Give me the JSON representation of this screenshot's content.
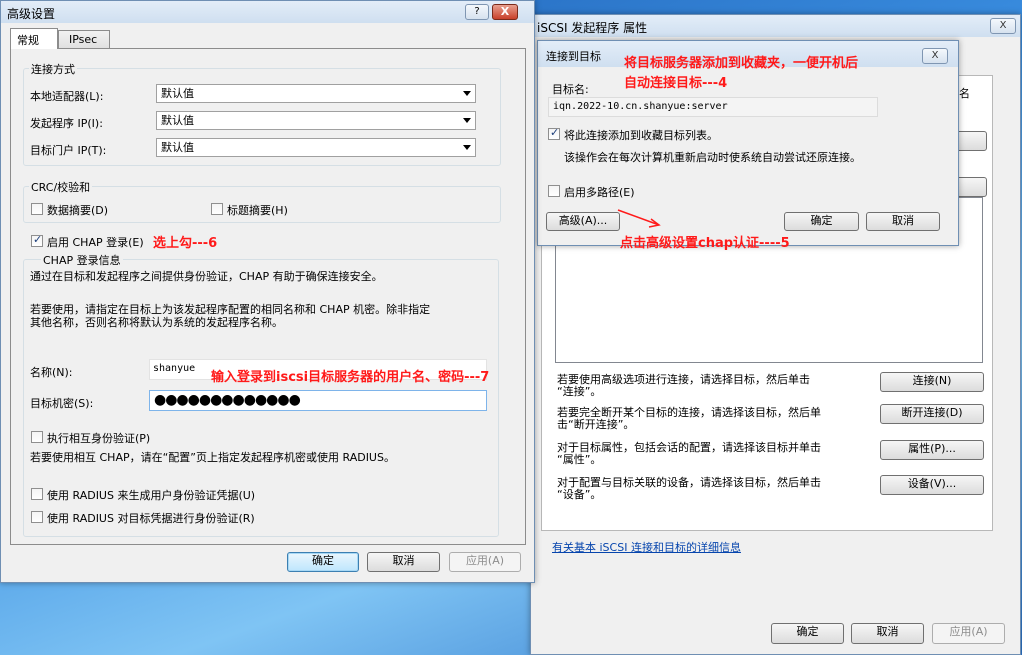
{
  "adv": {
    "title": "高级设置",
    "tabs": [
      "常规",
      "IPsec"
    ],
    "conn_legend": "连接方式",
    "local_adapter_label": "本地适配器(L):",
    "initiator_ip_label": "发起程序 IP(I):",
    "target_portal_label": "目标门户 IP(T):",
    "local_adapter_value": "默认值",
    "initiator_ip_value": "默认值",
    "target_portal_value": "默认值",
    "crc_legend": "CRC/校验和",
    "data_digest": "数据摘要(D)",
    "header_digest": "标题摘要(H)",
    "enable_chap": "启用 CHAP 登录(E)",
    "chap_legend": "CHAP 登录信息",
    "chap_desc1": "通过在目标和发起程序之间提供身份验证，CHAP 有助于确保连接安全。",
    "chap_desc2": "若要使用，请指定在目标上为该发起程序配置的相同名称和 CHAP 机密。除非指定",
    "chap_desc3": "其他名称，否则名称将默认为系统的发起程序名称。",
    "name_label": "名称(N):",
    "name_value": "shanyue",
    "secret_label": "目标机密(S):",
    "secret_value": "●●●●●●●●●●●●●",
    "mutual_auth": "执行相互身份验证(P)",
    "mutual_desc": "若要使用相互 CHAP，请在“配置”页上指定发起程序机密或使用 RADIUS。",
    "radius1": "使用 RADIUS 来生成用户身份验证凭据(U)",
    "radius2": "使用 RADIUS 对目标凭据进行身份验证(R)",
    "ok": "确定",
    "cancel": "取消",
    "apply": "应用(A)",
    "help_icon": "?",
    "close_icon": "X"
  },
  "props": {
    "title": "iSCSI 发起程序 属性",
    "fragment_name": "名",
    "hint1a": "若要使用高级选项进行连接，请选择目标，然后单击",
    "hint1b": "“连接”。",
    "hint2a": "若要完全断开某个目标的连接，请选择该目标，然后单",
    "hint2b": "击“断开连接”。",
    "hint3a": "对于目标属性，包括会话的配置，请选择该目标并单击",
    "hint3b": "“属性”。",
    "hint4a": "对于配置与目标关联的设备，请选择该目标，然后单击",
    "hint4b": "“设备”。",
    "btn_connect": "连接(N)",
    "btn_disconnect": "断开连接(D)",
    "btn_properties": "属性(P)...",
    "btn_devices": "设备(V)...",
    "link": "有关基本 iSCSI 连接和目标的详细信息",
    "ok": "确定",
    "cancel": "取消",
    "apply": "应用(A)",
    "close_icon": "X"
  },
  "connect": {
    "title": "连接到目标",
    "target_name_label": "目标名:",
    "target_name_value": "iqn.2022-10.cn.shanyue:server",
    "add_favorite": "将此连接添加到收藏目标列表。",
    "add_favorite_desc": "该操作会在每次计算机重新启动时使系统自动尝试还原连接。",
    "multipath": "启用多路径(E)",
    "advanced": "高级(A)...",
    "ok": "确定",
    "cancel": "取消",
    "close_icon": "X"
  },
  "annotations": {
    "a4_line1": "将目标服务器添加到收藏夹，一便开机后",
    "a4_line2": "自动连接目标---4",
    "a5": "点击高级设置chap认证----5",
    "a6": "选上勾---6",
    "a7": "输入登录到iscsi目标服务器的用户名、密码---7"
  },
  "colors": {
    "annotation": "#ff1a1a",
    "link": "#0645ad"
  }
}
